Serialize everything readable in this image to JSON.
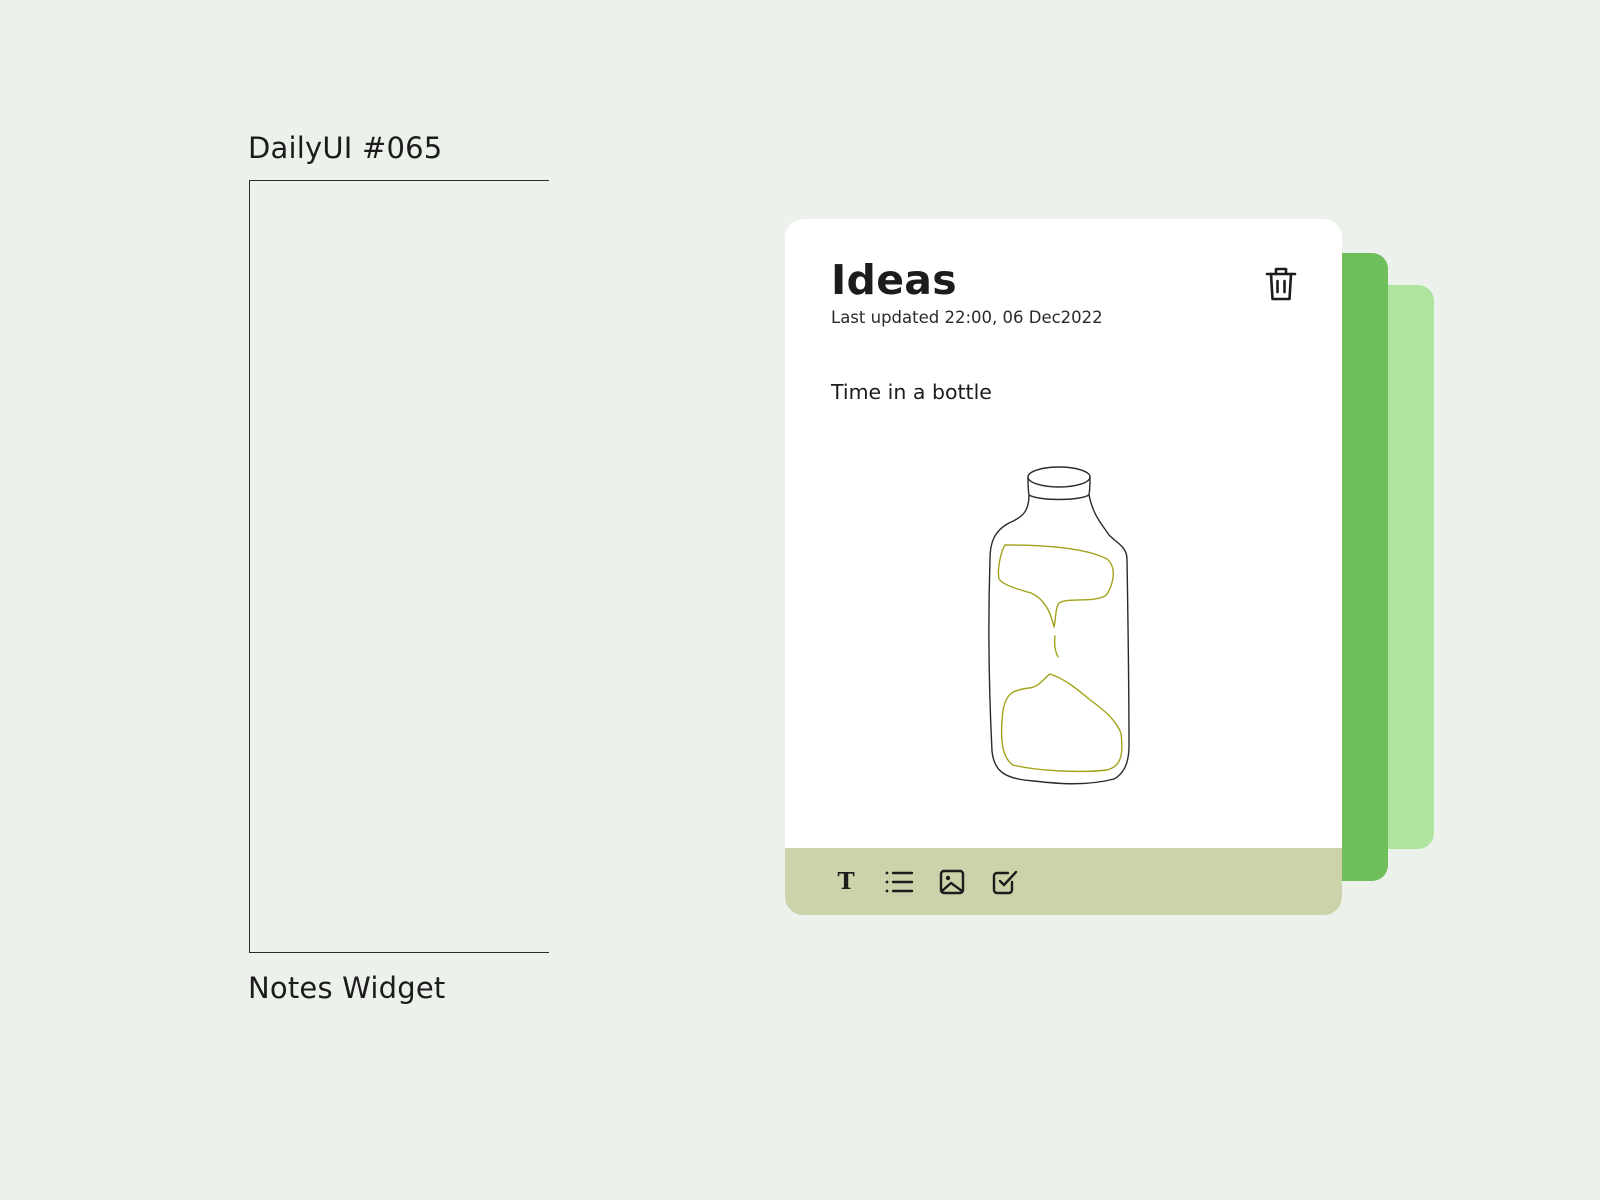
{
  "shot": {
    "title": "DailyUI #065",
    "caption": "Notes Widget"
  },
  "note": {
    "title": "Ideas",
    "updated": "Last updated 22:00, 06 Dec2022",
    "body_text": "Time in a bottle",
    "sketch": "hourglass-in-bottle",
    "delete_icon": "trash-icon"
  },
  "toolbar": {
    "tools": [
      {
        "icon": "text-format-icon",
        "glyph": "T"
      },
      {
        "icon": "bullet-list-icon"
      },
      {
        "icon": "image-icon"
      },
      {
        "icon": "checkbox-icon"
      }
    ]
  },
  "colors": {
    "background": "#ecf2eb",
    "card": "#ffffff",
    "toolbar": "#ccd3ab",
    "layer_middle": "#6ebe5c",
    "layer_back": "#aee59e",
    "ink": "#1c1c1c",
    "sand": "#a3a31a"
  }
}
